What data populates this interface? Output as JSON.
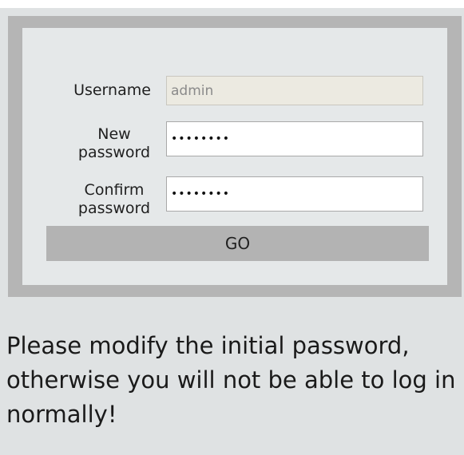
{
  "form": {
    "username": {
      "label": "Username",
      "value": "admin"
    },
    "new_password": {
      "label_line1": "New",
      "label_line2": "password",
      "value": "••••••••"
    },
    "confirm_password": {
      "label_line1": "Confirm",
      "label_line2": "password",
      "value": "••••••••"
    },
    "submit_label": "GO"
  },
  "notice": {
    "text": "Please modify the initial password, otherwise you will not be able to log in normally!"
  }
}
